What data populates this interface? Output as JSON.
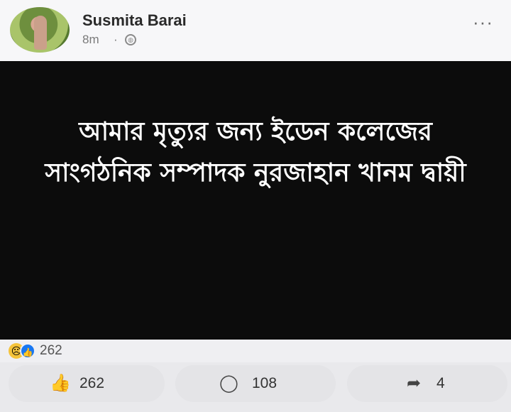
{
  "post": {
    "author": "Susmita Barai",
    "time": "8m",
    "separator": "·",
    "privacy_icon": "globe-icon",
    "more_label": "···",
    "image_text": {
      "line1": "আমার মৃত্যুর জন্য ইডেন কলেজের",
      "line2": "সাংগঠনিক সম্পাদক নুরজাহান খানম দ্বায়ী"
    }
  },
  "reactions": {
    "icons": [
      "sad-reaction-icon",
      "like-reaction-icon"
    ],
    "count": "262"
  },
  "actions": {
    "like_count": "262",
    "comment_count": "108",
    "share_count": "4"
  },
  "colors": {
    "image_background": "#0c0c0c",
    "like_blue": "#1877f2",
    "sad_yellow": "#f5c33b"
  }
}
